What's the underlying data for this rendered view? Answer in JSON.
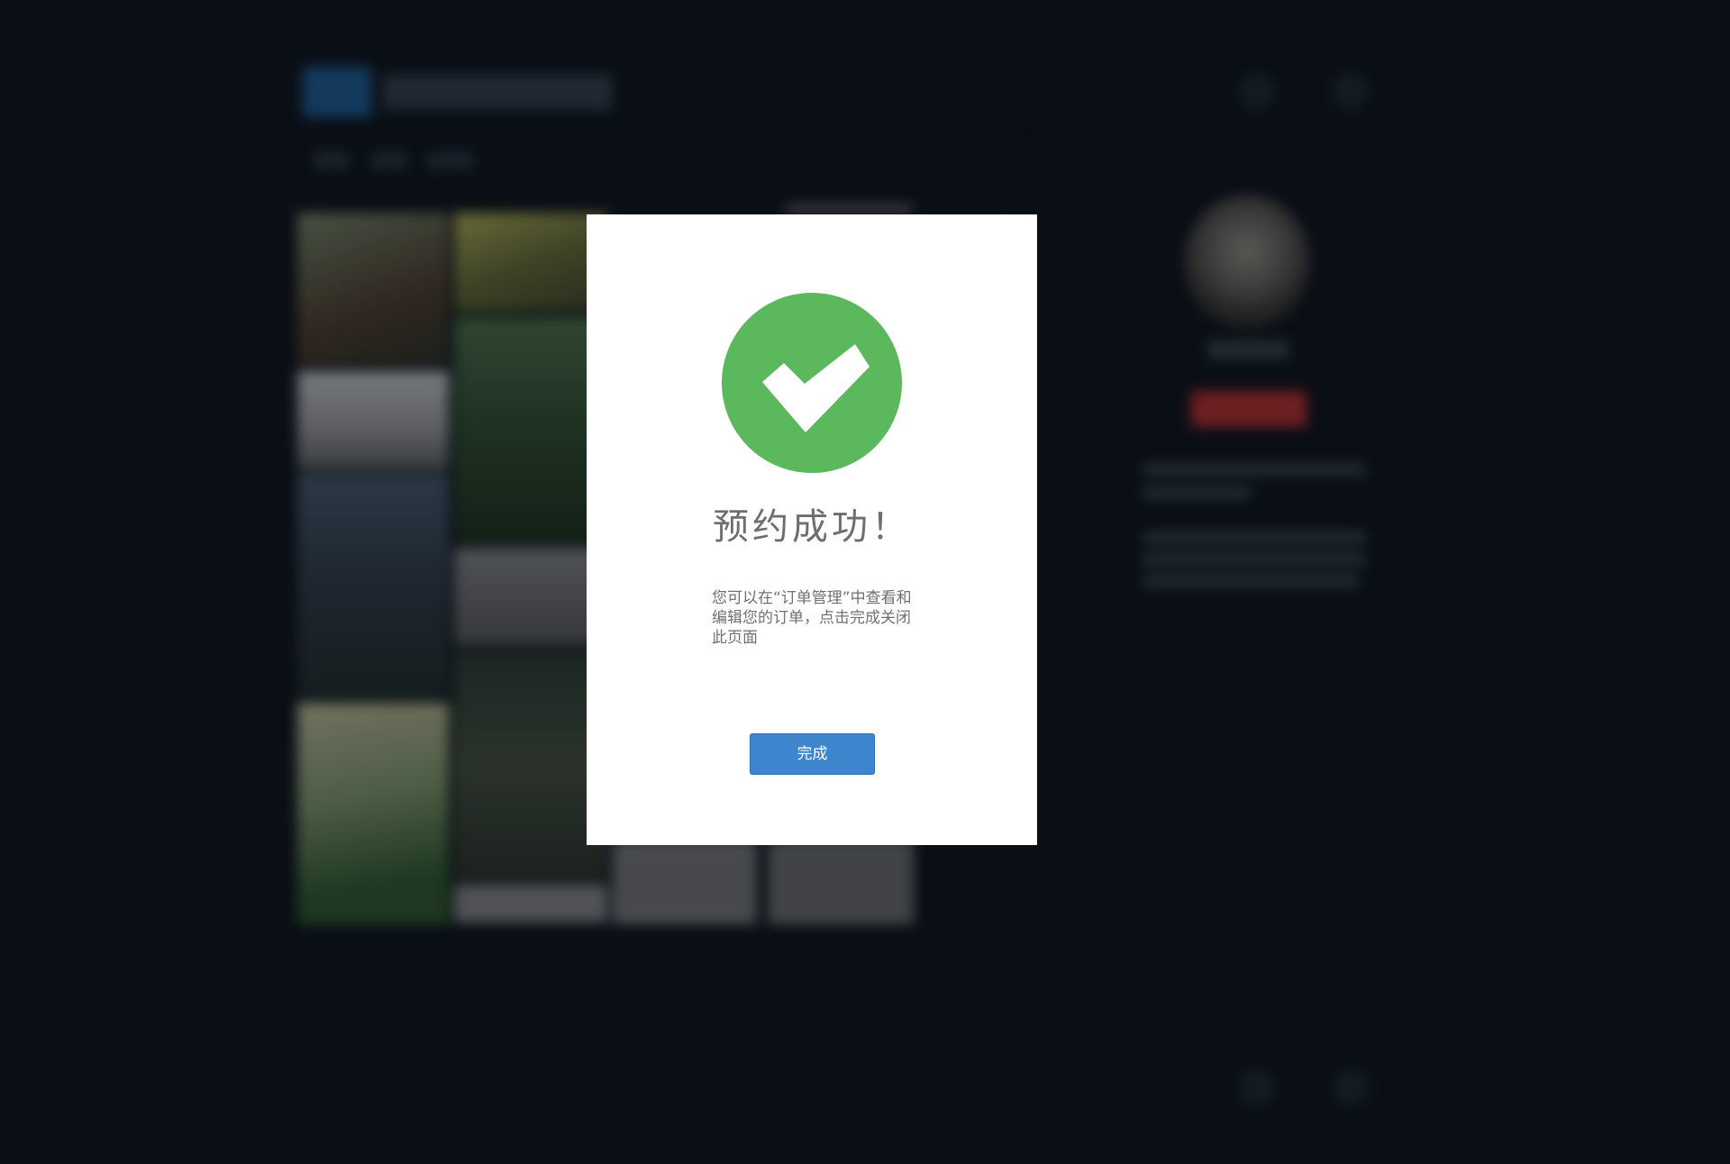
{
  "modal": {
    "title": "预约成功！",
    "message": "您可以在“订单管理”中查看和编辑您的订单，点击完成关闭此页面",
    "done_label": "完成",
    "icon": "check-circle-icon",
    "icon_color": "#5cb85c",
    "button_color": "#3d86cd"
  },
  "background": {
    "state": "blurred",
    "overlay_color": "#0a0f16"
  }
}
